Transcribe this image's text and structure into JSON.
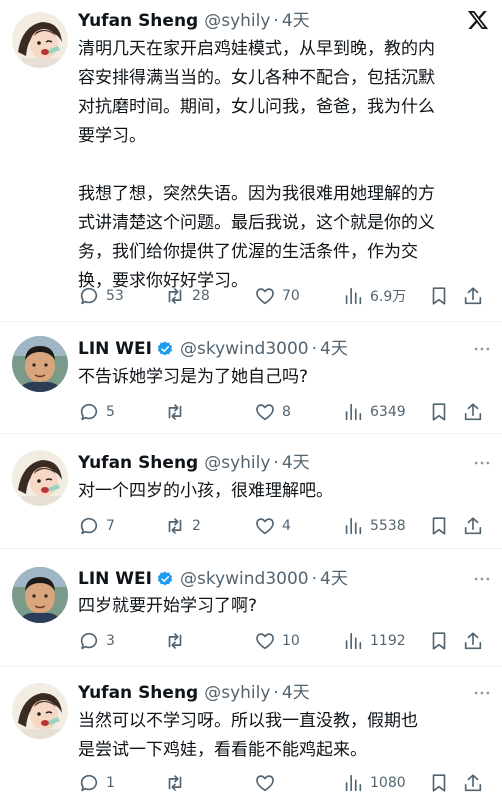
{
  "tweets": [
    {
      "author_name": "Yufan Sheng",
      "handle": "@syhily",
      "separator": "·",
      "time": "4天",
      "verified": false,
      "avatar": "cartoon-girl-avatar",
      "paragraphs": [
        "清明几天在家开启鸡娃模式，从早到晚，教的内\n容安排得满当当的。女儿各种不配合，包括沉默\n对抗磨时间。期间，女儿问我，爸爸，我为什么\n要学习。",
        "我想了想，突然失语。因为我很难用她理解的方\n式讲清楚这个问题。最后我说，这个就是你的义\n务，我们给你提供了优渥的生活条件，作为交\n换，要求你好好学习。"
      ],
      "replies": "53",
      "retweets": "28",
      "likes": "70",
      "views": "6.9万"
    },
    {
      "author_name": "LIN WEI",
      "handle": "@skywind3000",
      "separator": "·",
      "time": "4天",
      "verified": true,
      "avatar": "man-photo-avatar",
      "paragraphs": [
        "不告诉她学习是为了她自己吗?"
      ],
      "replies": "5",
      "retweets": "",
      "likes": "8",
      "views": "6349"
    },
    {
      "author_name": "Yufan Sheng",
      "handle": "@syhily",
      "separator": "·",
      "time": "4天",
      "verified": false,
      "avatar": "cartoon-girl-avatar",
      "paragraphs": [
        "对一个四岁的小孩，很难理解吧。"
      ],
      "replies": "7",
      "retweets": "2",
      "likes": "4",
      "views": "5538"
    },
    {
      "author_name": "LIN WEI",
      "handle": "@skywind3000",
      "separator": "·",
      "time": "4天",
      "verified": true,
      "avatar": "man-photo-avatar",
      "paragraphs": [
        "四岁就要开始学习了啊?"
      ],
      "replies": "3",
      "retweets": "",
      "likes": "10",
      "views": "1192"
    },
    {
      "author_name": "Yufan Sheng",
      "handle": "@syhily",
      "separator": "·",
      "time": "4天",
      "verified": false,
      "avatar": "cartoon-girl-avatar",
      "paragraphs": [
        "当然可以不学习呀。所以我一直没教，假期也\n是尝试一下鸡娃，看看能不能鸡起来。"
      ],
      "replies": "1",
      "retweets": "",
      "likes": "",
      "views": "1080"
    }
  ],
  "colors": {
    "text": "#0f1419",
    "secondary": "#536471",
    "verified": "#1d9bf0",
    "divider": "#eff3f4"
  },
  "icons": {
    "brand": "x-logo-icon",
    "more": "more-dots-icon",
    "reply": "reply-icon",
    "retweet": "retweet-icon",
    "like": "heart-icon",
    "views": "views-chart-icon",
    "bookmark": "bookmark-icon",
    "share": "share-icon"
  }
}
